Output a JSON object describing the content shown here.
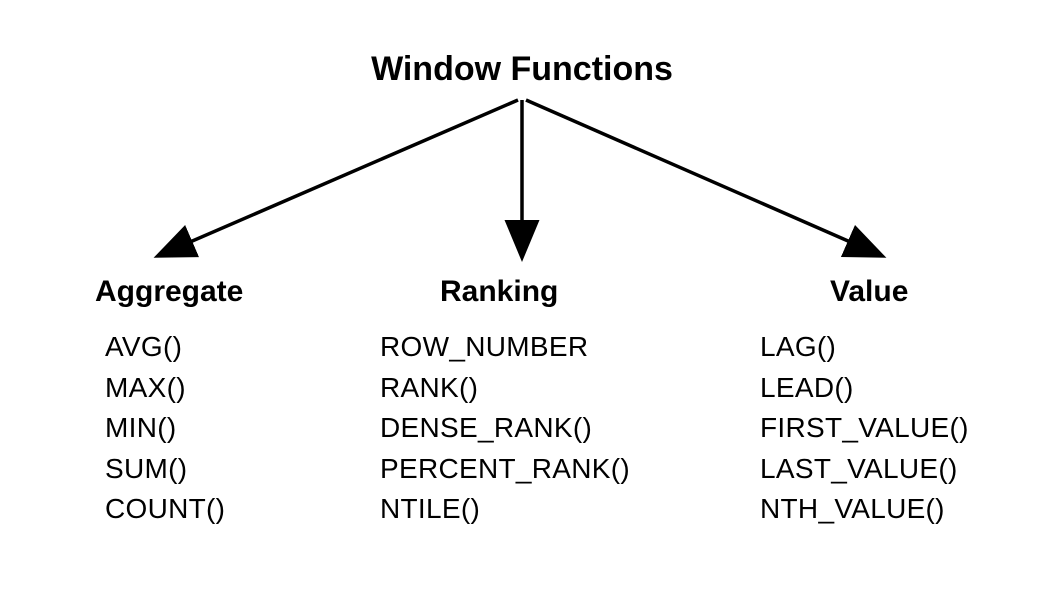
{
  "title": "Window Functions",
  "categories": [
    {
      "name": "Aggregate",
      "functions": [
        "AVG()",
        "MAX()",
        "MIN()",
        "SUM()",
        "COUNT()"
      ]
    },
    {
      "name": "Ranking",
      "functions": [
        "ROW_NUMBER",
        "RANK()",
        "DENSE_RANK()",
        "PERCENT_RANK()",
        "NTILE()"
      ]
    },
    {
      "name": "Value",
      "functions": [
        "LAG()",
        "LEAD()",
        "FIRST_VALUE()",
        "LAST_VALUE()",
        "NTH_VALUE()"
      ]
    }
  ]
}
